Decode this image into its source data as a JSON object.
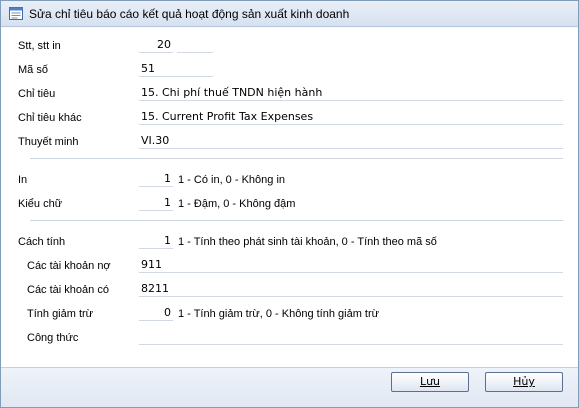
{
  "window": {
    "title": "Sửa chỉ tiêu báo cáo kết quả hoạt động sản xuất kinh doanh",
    "icon": "form-edit-icon"
  },
  "form": {
    "stt": {
      "label": "Stt, stt in",
      "value": "20"
    },
    "ma_so": {
      "label": "Mã số",
      "value": "51"
    },
    "chi_tieu": {
      "label": "Chỉ tiêu",
      "value": "15. Chi phí thuế TNDN hiện hành"
    },
    "chi_tieu_khac": {
      "label": "Chỉ tiêu khác",
      "value": "15. Current Profit Tax Expenses"
    },
    "thuyet_minh": {
      "label": "Thuyết minh",
      "value": "VI.30"
    },
    "in": {
      "label": "In",
      "value": "1",
      "hint": "1 - Có in, 0 - Không in"
    },
    "kieu_chu": {
      "label": "Kiểu chữ",
      "value": "1",
      "hint": "1 - Đậm, 0 - Không đậm"
    },
    "cach_tinh": {
      "label": "Cách tính",
      "value": "1",
      "hint": "1 - Tính theo phát sinh tài khoản, 0 - Tính theo mã số"
    },
    "tk_no": {
      "label": "Các tài khoản nợ",
      "value": "911"
    },
    "tk_co": {
      "label": "Các tài khoản có",
      "value": "8211"
    },
    "tinh_giam_tru": {
      "label": "Tính giảm trừ",
      "value": "0",
      "hint": "1 - Tính giảm trừ, 0 - Không tính giảm trừ"
    },
    "cong_thuc": {
      "label": "Công thức",
      "value": ""
    }
  },
  "buttons": {
    "save": "Lưu",
    "cancel": "Hủy"
  }
}
